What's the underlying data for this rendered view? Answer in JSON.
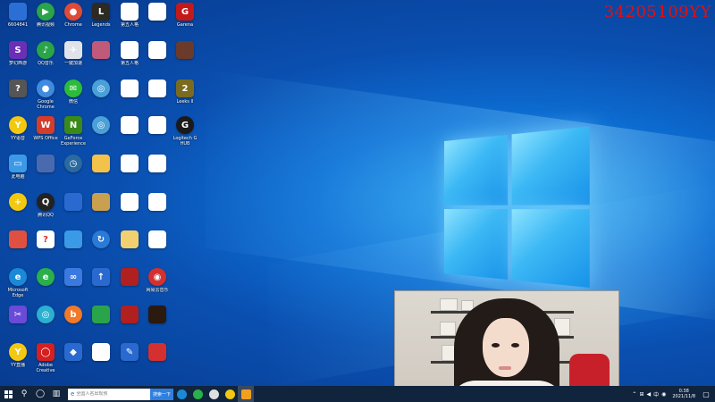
{
  "watermark": "34205109YY",
  "desktop": {
    "icons": [
      {
        "label": "6604841",
        "glyph": "",
        "color": "#2b6fd6"
      },
      {
        "label": "腾讯视频",
        "glyph": "▶",
        "color": "#2aa44a",
        "round": true
      },
      {
        "label": "Chrome",
        "glyph": "●",
        "color": "#dd4b39",
        "round": true
      },
      {
        "label": "Legends",
        "glyph": "L",
        "color": "#2d2a23"
      },
      {
        "label": "第五人格",
        "glyph": "",
        "color": "#ffffff"
      },
      {
        "label": "",
        "glyph": "",
        "color": "#ffffff"
      },
      {
        "label": "Garena",
        "glyph": "G",
        "color": "#c21a1a"
      },
      {
        "label": "梦幻西游",
        "glyph": "S",
        "color": "#6a2fb5"
      },
      {
        "label": "QQ音乐",
        "glyph": "♪",
        "color": "#2aa44a",
        "round": true
      },
      {
        "label": "一键加速",
        "glyph": "✈",
        "color": "#e0e4ea"
      },
      {
        "label": "",
        "glyph": "",
        "color": "#c05a7a"
      },
      {
        "label": "第五人格",
        "glyph": "",
        "color": "#ffffff"
      },
      {
        "label": "",
        "glyph": "",
        "color": "#ffffff"
      },
      {
        "label": "",
        "glyph": "",
        "color": "#6a3a2a"
      },
      {
        "label": "",
        "glyph": "?",
        "color": "#555555"
      },
      {
        "label": "Google Chrome",
        "glyph": "●",
        "color": "#3f8be0",
        "round": true
      },
      {
        "label": "微信",
        "glyph": "✉",
        "color": "#2dbb3a",
        "round": true
      },
      {
        "label": "",
        "glyph": "◎",
        "color": "#4aa0d8",
        "round": true
      },
      {
        "label": "",
        "glyph": "",
        "color": "#ffffff"
      },
      {
        "label": "",
        "glyph": "",
        "color": "#ffffff"
      },
      {
        "label": "Leeks II",
        "glyph": "2",
        "color": "#7a6b20"
      },
      {
        "label": "YY语音",
        "glyph": "Y",
        "color": "#f2c811",
        "round": true
      },
      {
        "label": "WPS Office",
        "glyph": "W",
        "color": "#d43c2c"
      },
      {
        "label": "GeForce Experience",
        "glyph": "N",
        "color": "#3a8a1a"
      },
      {
        "label": "",
        "glyph": "◎",
        "color": "#4aa0d8",
        "round": true
      },
      {
        "label": "",
        "glyph": "",
        "color": "#ffffff"
      },
      {
        "label": "",
        "glyph": "",
        "color": "#ffffff"
      },
      {
        "label": "Logitech G HUB",
        "glyph": "G",
        "color": "#1a1a1a",
        "round": true
      },
      {
        "label": "此电脑",
        "glyph": "▭",
        "color": "#3a9ae8"
      },
      {
        "label": "",
        "glyph": "",
        "color": "#4a6ab0"
      },
      {
        "label": "",
        "glyph": "◷",
        "color": "#2a6aa0",
        "round": true
      },
      {
        "label": "",
        "glyph": "",
        "color": "#f2c24a"
      },
      {
        "label": "",
        "glyph": "",
        "color": "#ffffff"
      },
      {
        "label": "",
        "glyph": "",
        "color": "#ffffff"
      },
      {
        "label": "",
        "glyph": "+",
        "color": "#f2c811",
        "round": true
      },
      {
        "label": "腾讯QQ",
        "glyph": "Q",
        "color": "#222222",
        "round": true
      },
      {
        "label": "",
        "glyph": "",
        "color": "#2a6ad0"
      },
      {
        "label": "",
        "glyph": "",
        "color": "#c8a050"
      },
      {
        "label": "",
        "glyph": "",
        "color": "#ffffff"
      },
      {
        "label": "",
        "glyph": "",
        "color": "#ffffff"
      },
      {
        "label": "",
        "glyph": "",
        "color": "#e05040"
      },
      {
        "label": "",
        "glyph": "?",
        "color": "#ffffff"
      },
      {
        "label": "",
        "glyph": "",
        "color": "#3a9ae8"
      },
      {
        "label": "",
        "glyph": "↻",
        "color": "#2a7ad8",
        "round": true
      },
      {
        "label": "",
        "glyph": "",
        "color": "#f2d070"
      },
      {
        "label": "",
        "glyph": "",
        "color": "#ffffff"
      },
      {
        "label": "Microsoft Edge",
        "glyph": "e",
        "color": "#1a8ad8",
        "round": true
      },
      {
        "label": "",
        "glyph": "e",
        "color": "#2ab04a",
        "round": true
      },
      {
        "label": "",
        "glyph": "∞",
        "color": "#3a7ae0"
      },
      {
        "label": "",
        "glyph": "↑",
        "color": "#2a6ad0"
      },
      {
        "label": "",
        "glyph": "",
        "color": "#b02020"
      },
      {
        "label": "网易云音乐",
        "glyph": "◉",
        "color": "#d43030",
        "round": true
      },
      {
        "label": "",
        "glyph": "✂",
        "color": "#6a4ad8"
      },
      {
        "label": "",
        "glyph": "◎",
        "color": "#2ab0d0",
        "round": true
      },
      {
        "label": "",
        "glyph": "b",
        "color": "#f07a2a",
        "round": true
      },
      {
        "label": "",
        "glyph": "",
        "color": "#2aa44a"
      },
      {
        "label": "",
        "glyph": "",
        "color": "#b02020"
      },
      {
        "label": "",
        "glyph": "",
        "color": "#2a1a10"
      },
      {
        "label": "YY直播",
        "glyph": "Y",
        "color": "#f2c811",
        "round": true
      },
      {
        "label": "Adobe Creative",
        "glyph": "◯",
        "color": "#d42020"
      },
      {
        "label": "",
        "glyph": "◆",
        "color": "#2a6ad0"
      },
      {
        "label": "",
        "glyph": "",
        "color": "#ffffff"
      },
      {
        "label": "",
        "glyph": "✎",
        "color": "#2a6ad0"
      },
      {
        "label": "",
        "glyph": "",
        "color": "#d43030"
      }
    ]
  },
  "taskbar": {
    "search_placeholder": "全国人名出现预",
    "search_button": "搜索一下",
    "clock_time": "0:38",
    "clock_date": "2021/11/8"
  }
}
